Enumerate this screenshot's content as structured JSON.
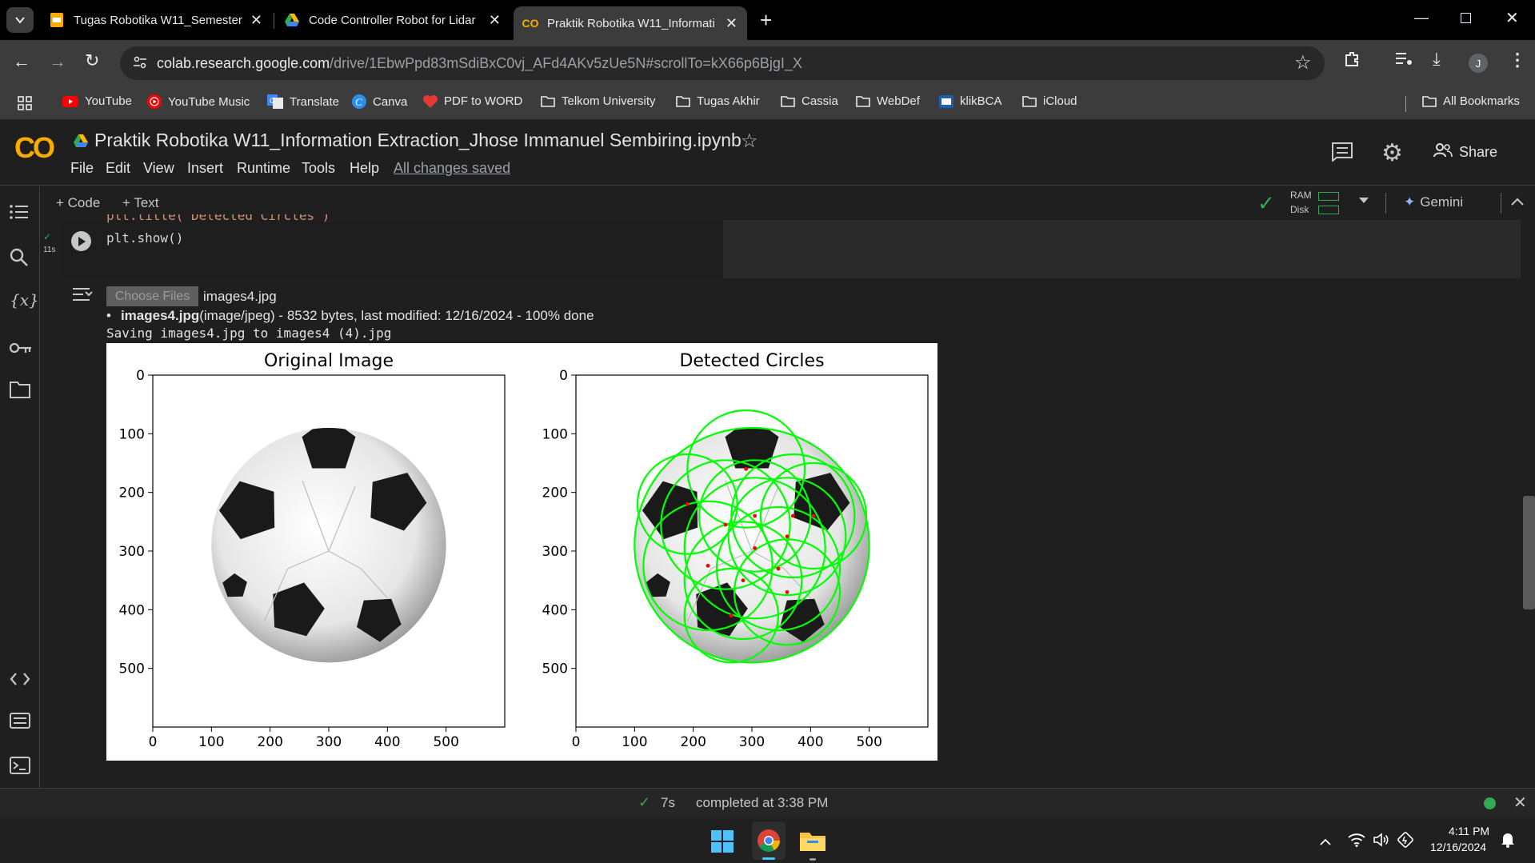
{
  "browser": {
    "tabs": [
      {
        "title": "Tugas Robotika W11_Semester",
        "icon": "google-slides-icon"
      },
      {
        "title": "Code Controller Robot for Lidar",
        "icon": "google-drive-icon"
      },
      {
        "title": "Praktik Robotika W11_Informati",
        "icon": "colab-icon",
        "active": true
      }
    ],
    "url_host": "colab.research.google.com",
    "url_path": "/drive/1EbwPpd83mSdiBxC0vj_AFd4AKv5zUe5N#scrollTo=kX66p6BjgI_X",
    "profile_initial": "J",
    "bookmarks": [
      {
        "label": "YouTube",
        "icon": "youtube-icon"
      },
      {
        "label": "YouTube Music",
        "icon": "youtube-music-icon"
      },
      {
        "label": "Translate",
        "icon": "translate-icon"
      },
      {
        "label": "Canva",
        "icon": "canva-icon"
      },
      {
        "label": "PDF to WORD",
        "icon": "pdf-icon"
      },
      {
        "label": "Telkom University",
        "icon": "folder-icon"
      },
      {
        "label": "Tugas Akhir",
        "icon": "folder-icon"
      },
      {
        "label": "Cassia",
        "icon": "folder-icon"
      },
      {
        "label": "WebDef",
        "icon": "folder-icon"
      },
      {
        "label": "klikBCA",
        "icon": "klikbca-icon"
      },
      {
        "label": "iCloud",
        "icon": "folder-icon"
      }
    ],
    "all_bookmarks": "All Bookmarks"
  },
  "colab": {
    "logo": "CO",
    "notebook_title": "Praktik Robotika W11_Information Extraction_Jhose Immanuel Sembiring.ipynb",
    "menu": [
      "File",
      "Edit",
      "View",
      "Insert",
      "Runtime",
      "Tools",
      "Help"
    ],
    "save_status": "All changes saved",
    "share_label": "Share",
    "add_code": "+ Code",
    "add_text": "+ Text",
    "ram_label": "RAM",
    "disk_label": "Disk",
    "gemini_label": "Gemini"
  },
  "cell": {
    "exec_time": "11s",
    "code_lines": [
      "plt.title('Detected Circles')",
      "plt.show()"
    ]
  },
  "output": {
    "choose_files": "Choose Files",
    "chosen_file": "images4.jpg",
    "file_name_bold": "images4.jpg",
    "file_info": "(image/jpeg) - 8532 bytes, last modified: 12/16/2024 - 100% done",
    "saving_line": "Saving images4.jpg to images4 (4).jpg"
  },
  "chart_data": [
    {
      "type": "image",
      "title": "Original Image",
      "xticks": [
        0,
        100,
        200,
        300,
        400,
        500
      ],
      "yticks": [
        0,
        100,
        200,
        300,
        400,
        500
      ],
      "xlim": [
        0,
        600
      ],
      "ylim": [
        600,
        0
      ]
    },
    {
      "type": "image",
      "title": "Detected Circles",
      "xticks": [
        0,
        100,
        200,
        300,
        400,
        500
      ],
      "yticks": [
        0,
        100,
        200,
        300,
        400,
        500
      ],
      "xlim": [
        0,
        600
      ],
      "ylim": [
        600,
        0
      ],
      "circle_color": "#00ff00",
      "center_color": "#ff0000",
      "circles": [
        {
          "x": 300,
          "y": 290,
          "r": 200
        },
        {
          "x": 290,
          "y": 160,
          "r": 100
        },
        {
          "x": 190,
          "y": 220,
          "r": 85
        },
        {
          "x": 255,
          "y": 255,
          "r": 110
        },
        {
          "x": 305,
          "y": 240,
          "r": 95
        },
        {
          "x": 370,
          "y": 240,
          "r": 105
        },
        {
          "x": 405,
          "y": 240,
          "r": 90
        },
        {
          "x": 305,
          "y": 295,
          "r": 120
        },
        {
          "x": 360,
          "y": 275,
          "r": 100
        },
        {
          "x": 225,
          "y": 325,
          "r": 110
        },
        {
          "x": 345,
          "y": 330,
          "r": 105
        },
        {
          "x": 285,
          "y": 350,
          "r": 100
        },
        {
          "x": 360,
          "y": 370,
          "r": 90
        },
        {
          "x": 265,
          "y": 410,
          "r": 80
        }
      ]
    }
  ],
  "statusbar": {
    "duration": "7s",
    "completed": "completed at 3:38 PM"
  },
  "taskbar": {
    "time": "4:11 PM",
    "date": "12/16/2024"
  },
  "colors": {
    "accent_green": "#34a853",
    "colab_orange": "#f9ab00",
    "link_blue": "#8ab4f8"
  }
}
